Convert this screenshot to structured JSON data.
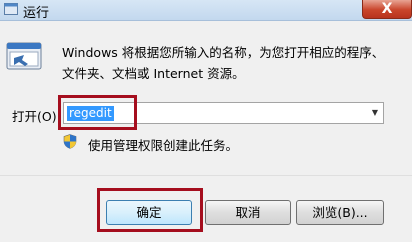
{
  "window": {
    "title": "运行",
    "title_icon": "run-app-icon",
    "close_glyph": "X",
    "close_icon": "close-icon"
  },
  "main": {
    "icon": "run-program-icon",
    "description_line1": "Windows 将根据您所输入的名称，为您打开相应的程序、",
    "description_line2": "文件夹、文档或 Internet 资源。",
    "open_label": "打开(O):",
    "open_value": "regedit",
    "dropdown_icon": "chevron-down-icon",
    "admin_icon": "uac-shield-icon",
    "admin_note": "使用管理权限创建此任务。"
  },
  "buttons": {
    "ok": "确定",
    "cancel": "取消",
    "browse": "浏览(B)..."
  },
  "annotations": {
    "highlight_color": "#a50e1e"
  }
}
